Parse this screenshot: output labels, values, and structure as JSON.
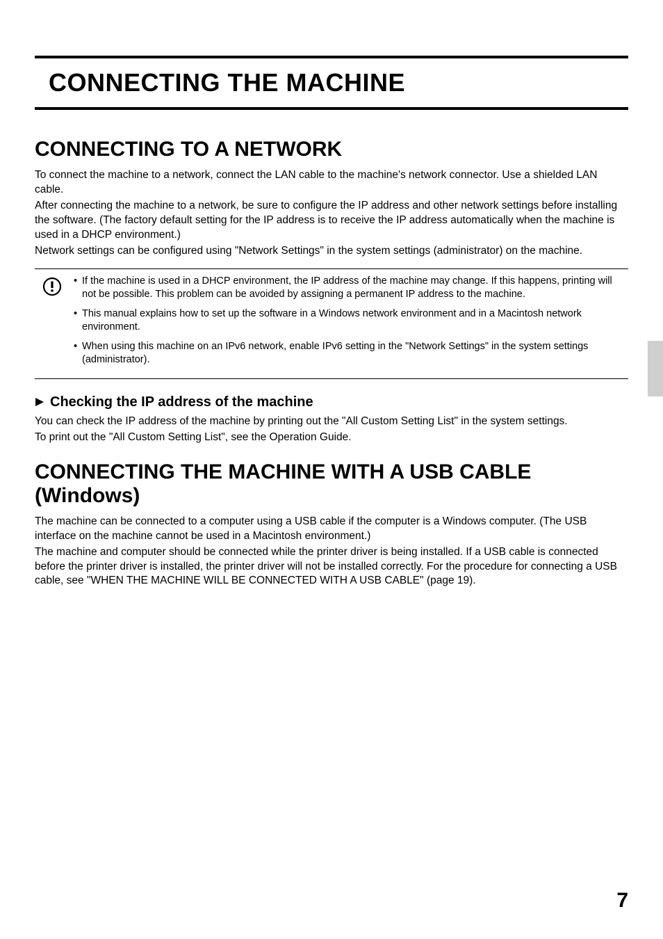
{
  "chapter_title": "CONNECTING THE MACHINE",
  "section1": {
    "title": "CONNECTING TO A NETWORK",
    "para1": "To connect the machine to a network, connect the LAN cable to the machine's network connector. Use a shielded LAN cable.",
    "para2": "After connecting the machine to a network, be sure to configure the IP address and other network settings before installing the software. (The factory default setting for the IP address is to receive the IP address automatically when the machine is used in a DHCP environment.)",
    "para3": "Network settings can be configured using \"Network Settings\" in the system settings (administrator) on the machine."
  },
  "callout": {
    "item1": "If the machine is used in a DHCP environment, the IP address of the machine may change. If this happens, printing will not be possible. This problem can be avoided by assigning a permanent IP address to the machine.",
    "item2": "This manual explains how to set up the software in a Windows network environment and in a Macintosh network environment.",
    "item3": "When using this machine on an IPv6 network, enable IPv6 setting in the \"Network Settings\" in the system settings (administrator)."
  },
  "subsection": {
    "heading": "Checking the IP address of the machine",
    "para1": "You can check the IP address of the machine by printing out the \"All Custom Setting List\" in the system settings.",
    "para2": "To print out the \"All Custom Setting List\", see the Operation Guide."
  },
  "section2": {
    "title": "CONNECTING THE MACHINE WITH A USB CABLE (Windows)",
    "para1": "The machine can be connected to a computer using a USB cable if the computer is a Windows computer. (The USB interface on the machine cannot be used in a Macintosh environment.)",
    "para2": "The machine and computer should be connected while the printer driver is being installed. If a USB cable is connected before the printer driver is installed, the printer driver will not be installed correctly. For the procedure for connecting a USB cable, see \"WHEN THE MACHINE WILL BE CONNECTED WITH A USB CABLE\" (page 19)."
  },
  "page_number": "7"
}
